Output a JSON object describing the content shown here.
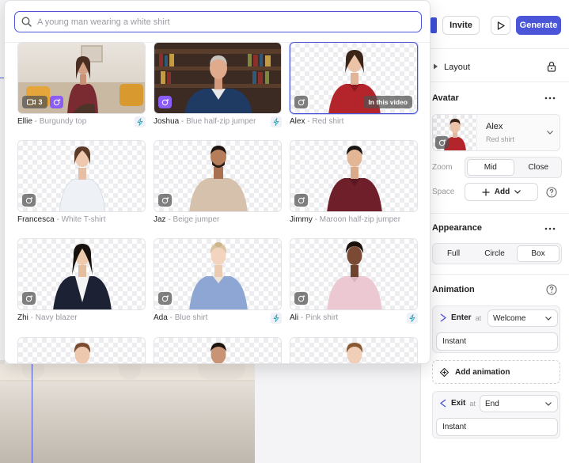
{
  "topbar": {
    "invite_label": "Invite",
    "generate_label": "Generate",
    "accent_color": "#4a55d8"
  },
  "search": {
    "placeholder": "A young man wearing a white shirt",
    "value": ""
  },
  "avatars": [
    {
      "name": "Ellie",
      "variant": "Burgundy top",
      "count": "3",
      "scene": "studio"
    },
    {
      "name": "Joshua",
      "variant": "Blue half-zip jumper",
      "scene": "library"
    },
    {
      "name": "Alex",
      "variant": "Red shirt",
      "tag": "In this video",
      "selected": true
    },
    {
      "name": "Francesca",
      "variant": "White T-shirt"
    },
    {
      "name": "Jaz",
      "variant": "Beige jumper"
    },
    {
      "name": "Jimmy",
      "variant": "Maroon half-zip jumper"
    },
    {
      "name": "Zhi",
      "variant": "Navy blazer"
    },
    {
      "name": "Ada",
      "variant": "Blue shirt"
    },
    {
      "name": "Ali",
      "variant": "Pink shirt"
    }
  ],
  "panel": {
    "layout": {
      "title": "Layout"
    },
    "avatar": {
      "title": "Avatar",
      "selected_name": "Alex",
      "selected_variant": "Red shirt",
      "zoom_label": "Zoom",
      "zoom_options": [
        "Mid",
        "Close"
      ],
      "zoom_selected": "Mid",
      "space_label": "Space",
      "add_label": "Add"
    },
    "appearance": {
      "title": "Appearance",
      "options": [
        "Full",
        "Circle",
        "Box"
      ],
      "selected": "Box"
    },
    "animation": {
      "title": "Animation",
      "enter": {
        "label": "Enter",
        "at": "at",
        "select_value": "Welcome",
        "style": "Instant"
      },
      "add_label": "Add animation",
      "exit": {
        "label": "Exit",
        "at": "at",
        "select_value": "End",
        "style": "Instant"
      }
    }
  },
  "icons": {
    "search": "search-icon",
    "play": "play-icon",
    "lock": "lock-icon",
    "more": "more-icon",
    "help": "help-icon",
    "chevron": "chevron-down-icon",
    "bolt": "bolt-icon",
    "sparkle": "sparkle-icon",
    "camera": "camera-icon"
  }
}
